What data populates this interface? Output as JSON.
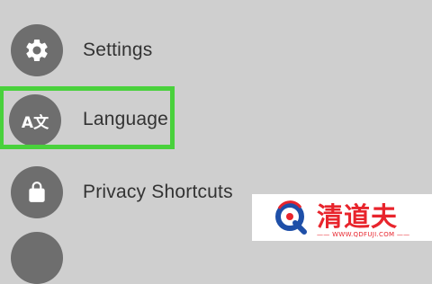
{
  "menu": {
    "items": [
      {
        "label": "Settings",
        "icon": "gear-icon"
      },
      {
        "label": "Language",
        "icon": "translate-icon",
        "icon_text": "A文",
        "highlighted": true
      },
      {
        "label": "Privacy Shortcuts",
        "icon": "lock-icon"
      }
    ]
  },
  "watermark": {
    "brand": "清道夫",
    "url": "—— WWW.QDFUJI.COM ——"
  },
  "colors": {
    "background": "#cfcfcf",
    "icon_circle": "#6e6e6e",
    "highlight": "#49d13c",
    "watermark_red": "#e8242c"
  }
}
